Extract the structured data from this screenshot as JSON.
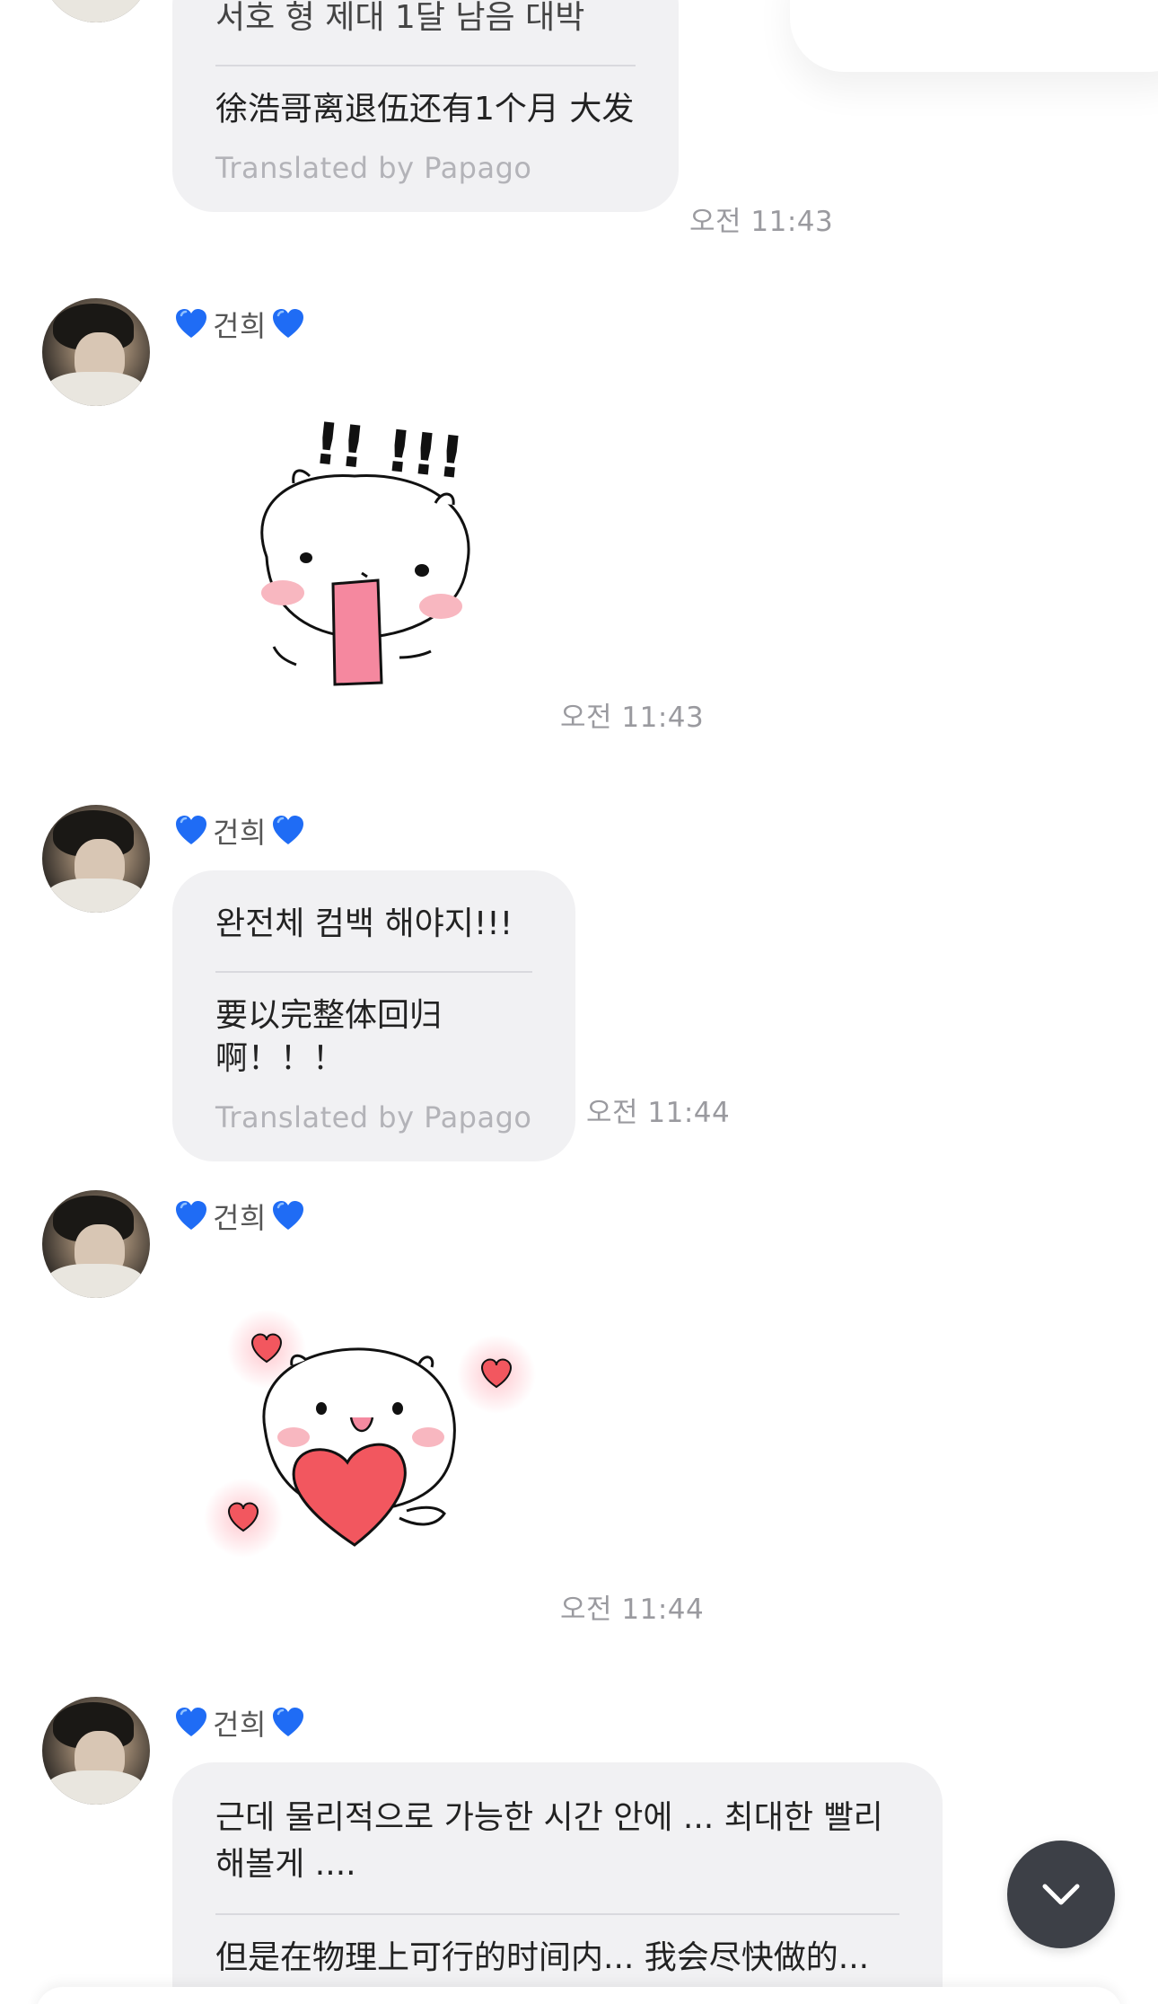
{
  "chat": {
    "sender_name": "건희",
    "credit_label": "Translated by Papago",
    "messages": [
      {
        "type": "text",
        "original": "서호 형 제대 1달 남음 대박",
        "translation": "徐浩哥离退伍还有1个月 大发",
        "time": "오전 11:43"
      },
      {
        "type": "sticker",
        "sticker": "surprised-hamster-sticker",
        "sticker_text": "!! !!!",
        "time": "오전 11:43"
      },
      {
        "type": "text",
        "original": "완전체 컴백 해야지!!!",
        "translation": "要以完整体回归啊！！！",
        "time": "오전 11:44"
      },
      {
        "type": "sticker",
        "sticker": "heart-hamster-sticker",
        "time": "오전 11:44"
      },
      {
        "type": "text",
        "original": "근데 물리적으로 가능한 시간 안에 ... 최대한 빨리 해볼게 ....",
        "translation": "但是在物理上可行的时间内... 我会尽快做的..."
      }
    ]
  },
  "icons": {
    "sender_emoji": "blue-heart-icon",
    "scroll_down": "chevron-down-icon"
  },
  "colors": {
    "bubble_bg": "#f1f1f3",
    "scroll_button_bg": "#3d4047",
    "blue_heart": "#1f6cf5"
  }
}
